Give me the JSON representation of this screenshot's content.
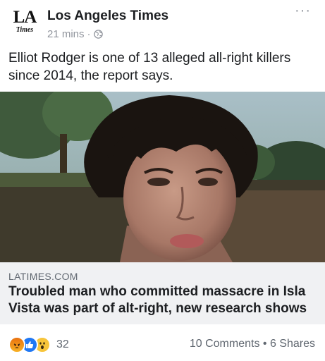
{
  "page": {
    "name": "Los Angeles Times",
    "logo_top": "LA",
    "logo_bottom": "Times",
    "time": "21 mins",
    "separator": "·"
  },
  "post": {
    "text": "Elliot Rodger is one of 13 alleged all-right killers since 2014, the report says."
  },
  "link": {
    "domain": "LATIMES.COM",
    "headline": "Troubled man who committed massacre in Isla Vista was part of alt-right, new research shows"
  },
  "engagement": {
    "reaction_icons": [
      "angry-reaction-icon",
      "like-reaction-icon",
      "wow-reaction-icon"
    ],
    "reaction_count": "32",
    "comments": "10 Comments",
    "shares": "6 Shares",
    "dot": "•"
  },
  "icons": {
    "more": "more-options-icon",
    "globe": "globe-icon"
  },
  "colors": {
    "link_box_bg": "#f0f1f3",
    "secondary_text": "#90949c",
    "like_blue": "#2078f4"
  }
}
